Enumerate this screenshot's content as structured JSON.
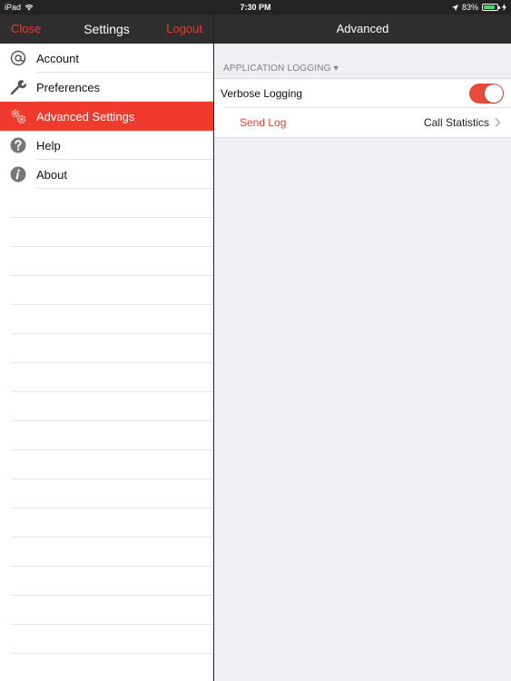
{
  "status_bar": {
    "device": "iPad",
    "time": "7:30 PM",
    "battery": "83%",
    "battery_level": 0.83
  },
  "left_panel": {
    "close_label": "Close",
    "title": "Settings",
    "logout_label": "Logout",
    "items": [
      {
        "label": "Account",
        "icon": "at-icon",
        "active": false
      },
      {
        "label": "Preferences",
        "icon": "wrench-icon",
        "active": false
      },
      {
        "label": "Advanced Settings",
        "icon": "gears-icon",
        "active": true
      },
      {
        "label": "Help",
        "icon": "help-icon",
        "active": false
      },
      {
        "label": "About",
        "icon": "info-icon",
        "active": false
      }
    ]
  },
  "right_panel": {
    "title": "Advanced",
    "section_header": "APPLICATION LOGGING ▾",
    "verbose_logging_label": "Verbose Logging",
    "verbose_logging_on": true,
    "send_log_label": "Send Log",
    "call_statistics_label": "Call Statistics"
  },
  "colors": {
    "accent": "#ef3a2d",
    "nav_bar": "#2e2e2e",
    "toggle_on": "#e84a3e"
  }
}
